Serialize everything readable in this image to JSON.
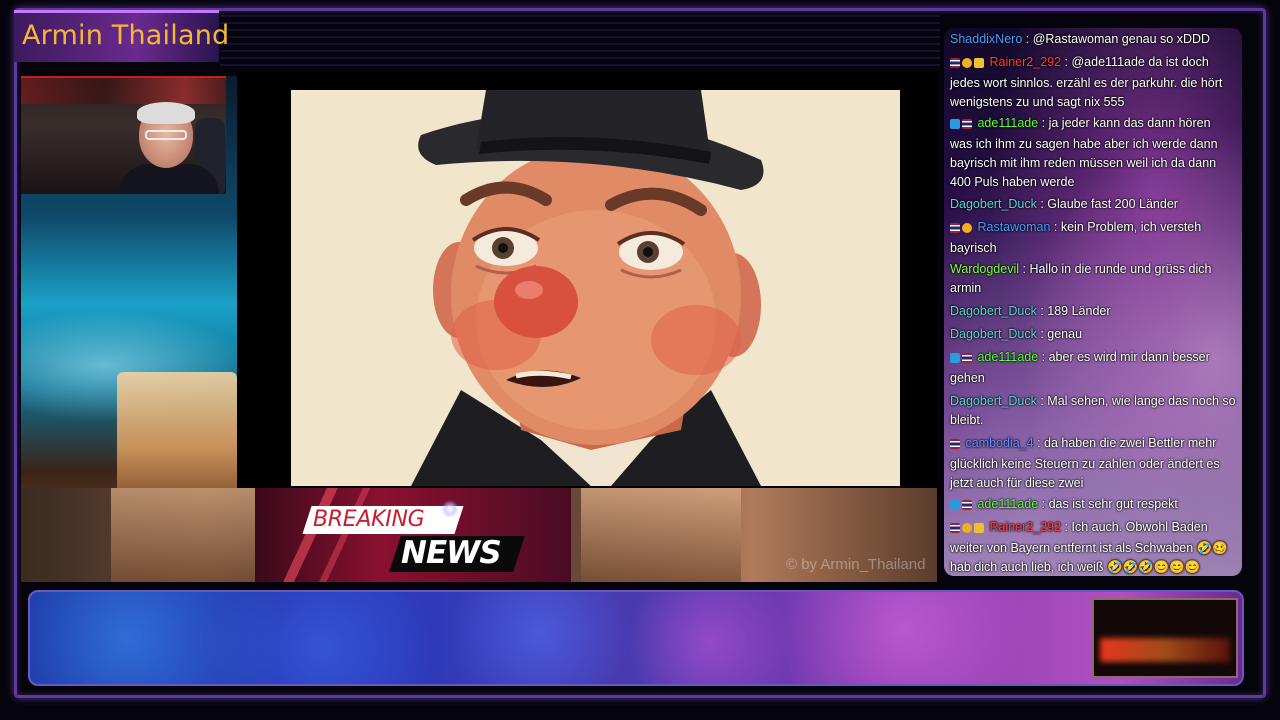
{
  "channel": {
    "title": "Armin Thailand"
  },
  "watermark": "© by Armin_Thailand",
  "breaking": {
    "top": "BREAKING",
    "bottom": "NEWS"
  },
  "chat": {
    "messages": [
      {
        "user": "ShaddixNero",
        "color": "#4a9cff",
        "badges": [],
        "text": "@Rastawoman genau so xDDD"
      },
      {
        "user": "Rainer2_292",
        "color": "#ff3a3a",
        "badges": [
          "flag",
          "coin",
          "crown"
        ],
        "text": "@ade111ade da ist doch jedes wort sinnlos. erzähl es der parkuhr. die hört wenigstens zu und sagt nix 555"
      },
      {
        "user": "ade111ade",
        "color": "#5aff3a",
        "badges": [
          "play",
          "flag"
        ],
        "text": "ja jeder kann das dann hören was ich ihm zu sagen habe aber ich werde dann bayrisch mit ihm reden müssen weil ich da dann 400 Puls haben werde"
      },
      {
        "user": "Dagobert_Duck",
        "color": "#5ad6d6",
        "badges": [],
        "text": "Glaube fast 200 Länder"
      },
      {
        "user": "Rastawoman",
        "color": "#4a9cff",
        "badges": [
          "flag",
          "coin"
        ],
        "text": "kein Problem, ich versteh bayrisch"
      },
      {
        "user": "Wardogdevil",
        "color": "#7aff3a",
        "badges": [],
        "text": "Hallo in die runde und grüss dich armin"
      },
      {
        "user": "Dagobert_Duck",
        "color": "#5ad6d6",
        "badges": [],
        "text": "189 Länder"
      },
      {
        "user": "Dagobert_Duck",
        "color": "#5ad6d6",
        "badges": [],
        "text": "genau"
      },
      {
        "user": "ade111ade",
        "color": "#5aff3a",
        "badges": [
          "play",
          "flag"
        ],
        "text": "aber es wird mir dann besser gehen"
      },
      {
        "user": "Dagobert_Duck",
        "color": "#5ad6d6",
        "badges": [],
        "text": "Mal sehen, wie lange das noch so bleibt."
      },
      {
        "user": "cambodia_4",
        "color": "#6a8aff",
        "badges": [
          "flag"
        ],
        "text": "da haben die zwei Bettler mehr glücklich keine Steuern zu zahlen oder ändert es jetzt auch für diese zwei"
      },
      {
        "user": "ade111ade",
        "color": "#5aff3a",
        "badges": [
          "play",
          "flag"
        ],
        "text": "das ist sehr gut respekt"
      },
      {
        "user": "Rainer2_292",
        "color": "#ff3a3a",
        "badges": [
          "flag",
          "coin",
          "crown"
        ],
        "text": "Ich auch. Obwohl Baden weiter von Bayern entfernt ist als Schwaben 🤣🥴 hab dich auch lieb, ich weiß 🤣🤣🤣😊😊😊"
      }
    ]
  }
}
